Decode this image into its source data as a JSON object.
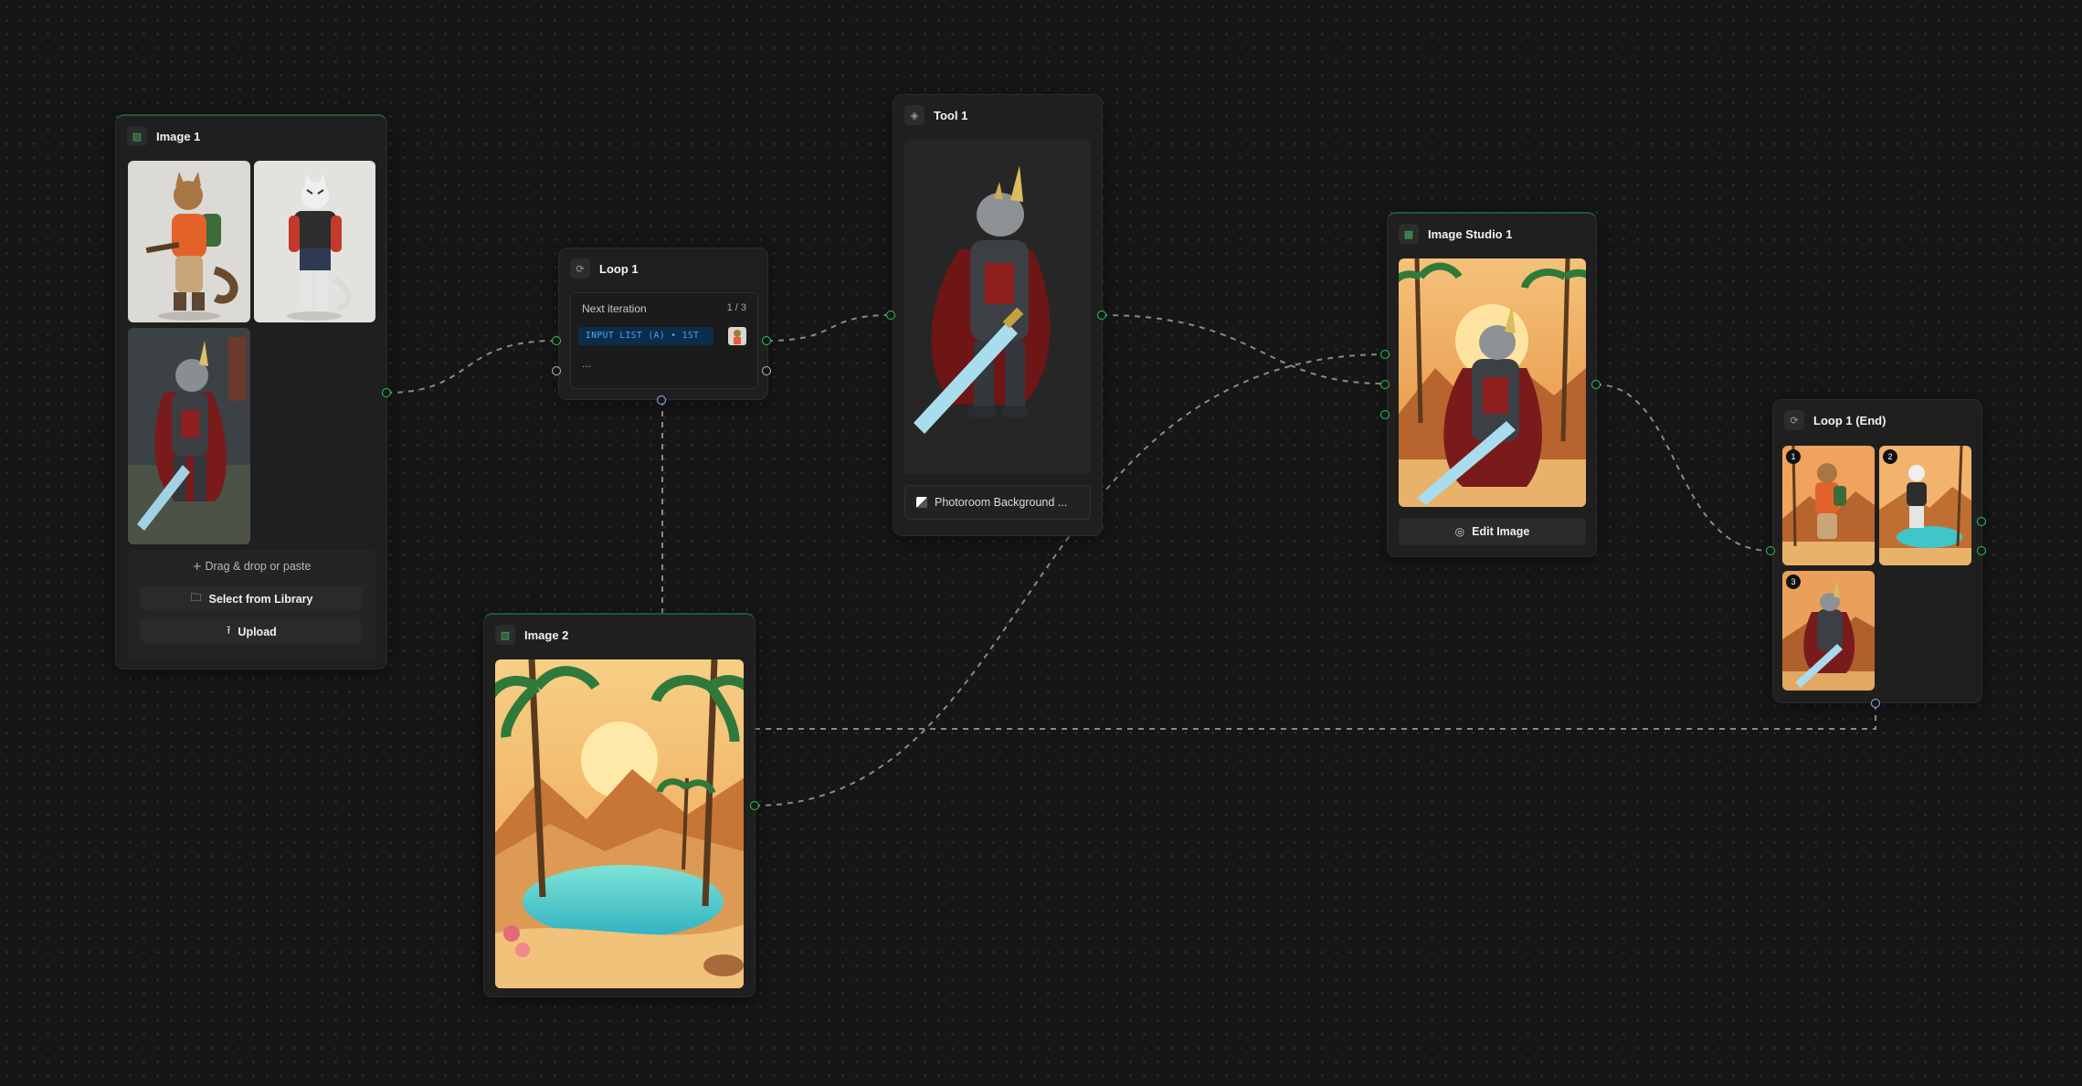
{
  "nodes": {
    "image1": {
      "title": "Image 1",
      "icon": "image-icon",
      "thumbnails": [
        {
          "name": "cat-adventurer-image"
        },
        {
          "name": "tiger-character-image"
        },
        {
          "name": "rhino-knight-image"
        }
      ],
      "drop_hint": "Drag & drop or paste",
      "select_label": "Select from Library",
      "upload_label": "Upload"
    },
    "loop1": {
      "title": "Loop 1",
      "icon": "loop-icon",
      "iteration_label": "Next iteration",
      "iteration_count": "1 / 3",
      "input_tag": "INPUT LIST (A) • 1ST",
      "ellipsis": "..."
    },
    "tool1": {
      "title": "Tool 1",
      "icon": "tool-icon",
      "tool_name": "Photoroom Background ..."
    },
    "image_studio1": {
      "title": "Image Studio 1",
      "icon": "image-studio-icon",
      "edit_label": "Edit Image"
    },
    "loop1_end": {
      "title": "Loop 1 (End)",
      "icon": "loop-icon",
      "results": [
        "1",
        "2",
        "3"
      ]
    },
    "image2": {
      "title": "Image 2",
      "icon": "image-icon"
    }
  },
  "colors": {
    "canvas": "#161616",
    "node": "#1f1f1f",
    "port_active": "#35c25f",
    "wire": "#8a8a8a",
    "input_tag_bg": "#0c2d4a",
    "input_tag_text": "#4aa8ff"
  }
}
